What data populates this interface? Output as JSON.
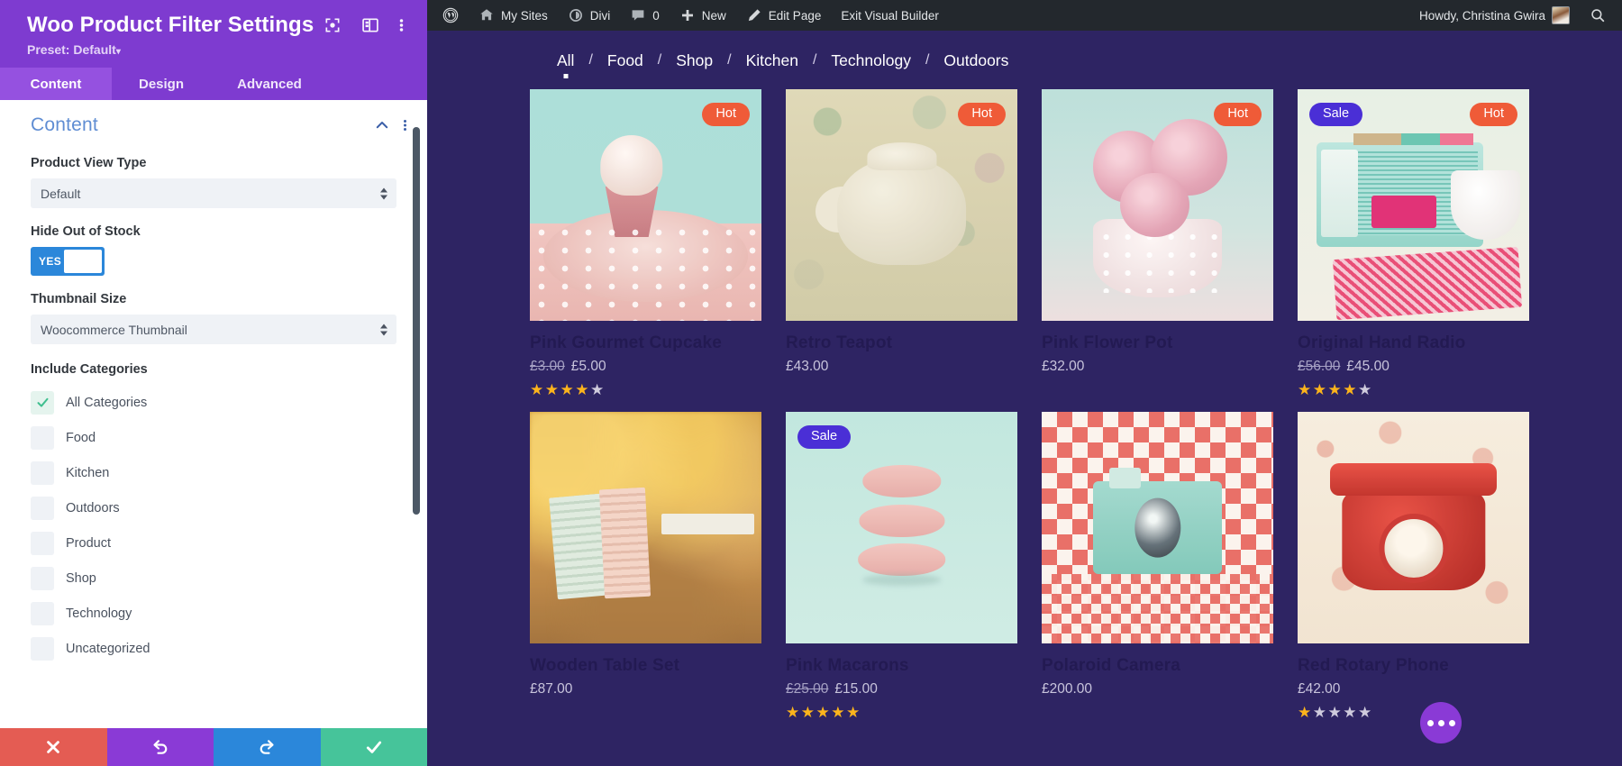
{
  "settings_panel": {
    "title": "Woo Product Filter Settings",
    "preset_label": "Preset: Default",
    "preset_caret": "▾",
    "header_icons": [
      {
        "name": "focus-target-icon",
        "label": "Focus"
      },
      {
        "name": "layout-columns-icon",
        "label": "Layout"
      },
      {
        "name": "more-vertical-icon",
        "label": "More Options"
      }
    ],
    "tabs": [
      {
        "label": "Content",
        "active": true
      },
      {
        "label": "Design",
        "active": false
      },
      {
        "label": "Advanced",
        "active": false
      }
    ],
    "section": {
      "title": "Content",
      "collapse_icon": "chevron-up-icon",
      "more_icon": "more-vertical-icon"
    },
    "fields": {
      "product_view_type": {
        "label": "Product View Type",
        "value": "Default",
        "options": [
          "Default"
        ]
      },
      "hide_out_of_stock": {
        "label": "Hide Out of Stock",
        "value": "YES"
      },
      "thumbnail_size": {
        "label": "Thumbnail Size",
        "value": "Woocommerce Thumbnail",
        "options": [
          "Woocommerce Thumbnail"
        ]
      },
      "include_categories": {
        "label": "Include Categories",
        "items": [
          {
            "label": "All Categories",
            "checked": true
          },
          {
            "label": "Food",
            "checked": false
          },
          {
            "label": "Kitchen",
            "checked": false
          },
          {
            "label": "Outdoors",
            "checked": false
          },
          {
            "label": "Product",
            "checked": false
          },
          {
            "label": "Shop",
            "checked": false
          },
          {
            "label": "Technology",
            "checked": false
          },
          {
            "label": "Uncategorized",
            "checked": false
          }
        ]
      }
    },
    "actions": [
      {
        "name": "cancel-button",
        "icon": "close-icon",
        "color": "#e45c53"
      },
      {
        "name": "undo-button",
        "icon": "undo-icon",
        "color": "#8a3ad6"
      },
      {
        "name": "redo-button",
        "icon": "redo-icon",
        "color": "#2b87da"
      },
      {
        "name": "save-button",
        "icon": "check-icon",
        "color": "#46c49a"
      }
    ]
  },
  "admin_bar": {
    "items": [
      {
        "name": "wordpress-logo-icon",
        "label": "",
        "icon": "wordpress-icon"
      },
      {
        "name": "my-sites-menu",
        "label": "My Sites",
        "icon": "sites-icon"
      },
      {
        "name": "divi-menu",
        "label": "Divi",
        "icon": "divi-icon"
      },
      {
        "name": "comments-menu",
        "label": "0",
        "icon": "comment-icon"
      },
      {
        "name": "new-menu",
        "label": "New",
        "icon": "plus-icon"
      },
      {
        "name": "edit-page-menu",
        "label": "Edit Page",
        "icon": "pencil-icon"
      },
      {
        "name": "exit-visual-builder",
        "label": "Exit Visual Builder",
        "icon": ""
      }
    ],
    "howdy": "Howdy, Christina Gwira",
    "search_icon": "search-icon"
  },
  "filter_bar": {
    "separator": "/",
    "items": [
      {
        "label": "All",
        "active": true
      },
      {
        "label": "Food",
        "active": false
      },
      {
        "label": "Shop",
        "active": false
      },
      {
        "label": "Kitchen",
        "active": false
      },
      {
        "label": "Technology",
        "active": false
      },
      {
        "label": "Outdoors",
        "active": false
      }
    ]
  },
  "products": [
    {
      "title": "Pink Gourmet Cupcake",
      "price_old": "£3.00",
      "price_new": "£5.00",
      "price_plain": "",
      "rating": 4,
      "badges": [
        {
          "label": "Hot",
          "type": "hot"
        }
      ],
      "art": "cupcake"
    },
    {
      "title": "Retro Teapot",
      "price_old": "",
      "price_new": "",
      "price_plain": "£43.00",
      "rating": 0,
      "badges": [
        {
          "label": "Hot",
          "type": "hot"
        }
      ],
      "art": "teapot"
    },
    {
      "title": "Pink Flower Pot",
      "price_old": "",
      "price_new": "",
      "price_plain": "£32.00",
      "rating": 0,
      "badges": [
        {
          "label": "Hot",
          "type": "hot"
        }
      ],
      "art": "roses"
    },
    {
      "title": "Original Hand Radio",
      "price_old": "£56.00",
      "price_new": "£45.00",
      "price_plain": "",
      "rating": 4,
      "badges": [
        {
          "label": "Sale",
          "type": "sale"
        },
        {
          "label": "Hot",
          "type": "hot"
        }
      ],
      "art": "radio"
    },
    {
      "title": "Wooden Table Set",
      "price_old": "",
      "price_new": "",
      "price_plain": "£87.00",
      "rating": 0,
      "badges": [],
      "art": "autumn"
    },
    {
      "title": "Pink Macarons",
      "price_old": "£25.00",
      "price_new": "£15.00",
      "price_plain": "",
      "rating": 5,
      "badges": [
        {
          "label": "Sale",
          "type": "sale"
        }
      ],
      "art": "macaron"
    },
    {
      "title": "Polaroid Camera",
      "price_old": "",
      "price_new": "",
      "price_plain": "£200.00",
      "rating": 0,
      "badges": [],
      "art": "polaroid"
    },
    {
      "title": "Red Rotary Phone",
      "price_old": "",
      "price_new": "",
      "price_plain": "£42.00",
      "rating": 1,
      "badges": [],
      "art": "phone"
    }
  ],
  "fab": {
    "name": "more-options-fab",
    "icon": "ellipsis-icon"
  },
  "colors": {
    "panel_purple": "#7e3bd0",
    "tab_active": "#9551e0",
    "builder_bg": "#2e2463",
    "admin_bar": "#23282d",
    "badge_hot": "#ef5b38",
    "badge_sale": "#4a2fd6",
    "toggle_on": "#2b87da",
    "star_on": "#fcb41c",
    "star_off": "#cfcbdd",
    "section_title": "#5f8dd3"
  }
}
